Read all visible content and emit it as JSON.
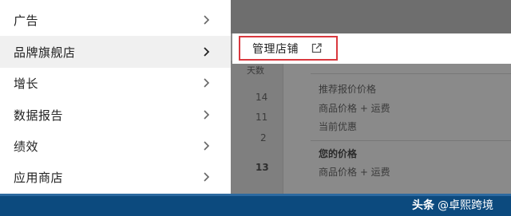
{
  "menu": {
    "items": [
      {
        "label": "广告"
      },
      {
        "label": "品牌旗舰店"
      },
      {
        "label": "增长"
      },
      {
        "label": "数据报告"
      },
      {
        "label": "绩效"
      },
      {
        "label": "应用商店"
      }
    ]
  },
  "flyout": {
    "label": "管理店铺",
    "icon": "external-link-icon",
    "highlight_color": "#d9383e"
  },
  "background": {
    "partial_label": "天数",
    "numbers": [
      "14",
      "11",
      "2",
      "13"
    ],
    "lines": [
      "推荐报价价格",
      "商品价格 + 运费",
      "当前优惠",
      "您的价格",
      "商品价格 + 运费"
    ]
  },
  "watermark": {
    "brand": "头条",
    "handle": "@卓熙跨境"
  },
  "colors": {
    "bottom_bar": "#0c4a7e",
    "overlay": "#8a8a8a"
  }
}
